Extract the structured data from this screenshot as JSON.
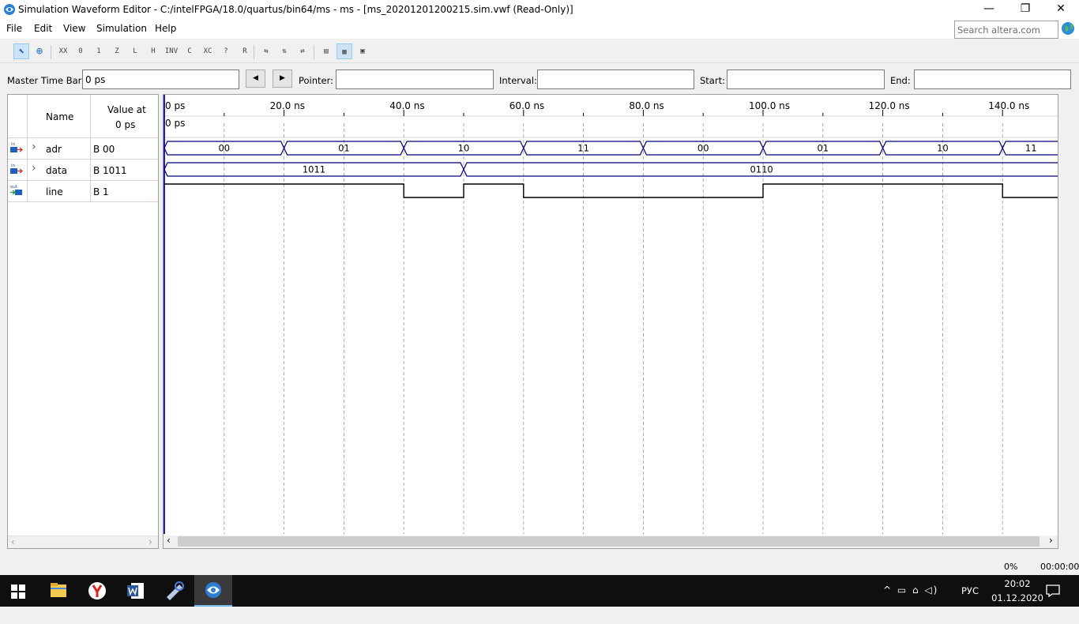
{
  "window": {
    "title": "Simulation Waveform Editor - C:/intelFPGA/18.0/quartus/bin64/ms - ms - [ms_20201201200215.sim.vwf (Read-Only)]",
    "minimize": "—",
    "restore": "❐",
    "close": "✕"
  },
  "menu": [
    "File",
    "Edit",
    "View",
    "Simulation",
    "Help"
  ],
  "search": {
    "placeholder": "Search altera.com"
  },
  "toolbar": {
    "buttons": [
      "select",
      "zoom",
      "uninitialized",
      "forcing-low",
      "forcing-high",
      "high-impedance",
      "weak-low",
      "weak-high",
      "invert",
      "count-value",
      "clock",
      "arbitrary-value",
      "random-value",
      "snap-to-grid",
      "sort",
      "grid-size",
      "overwrite-clock",
      "waveform-view",
      "tabular-view"
    ],
    "labels": [
      "⬉",
      "⊕",
      "XX",
      "0",
      "1",
      "Z",
      "L",
      "H",
      "INV",
      "C",
      "XC",
      "?",
      "R",
      "⇆",
      "⇅",
      "⇄",
      "▤",
      "▦",
      "▣"
    ]
  },
  "timebar": {
    "master_label": "Master Time Bar:",
    "master_value": "0 ps",
    "prev_label": "◀",
    "next_label": "▶",
    "pointer_label": "Pointer:",
    "pointer_value": "",
    "interval_label": "Interval:",
    "interval_value": "",
    "start_label": "Start:",
    "start_value": "",
    "end_label": "End:",
    "end_value": ""
  },
  "signal_table": {
    "col_name": "Name",
    "col_value_line1": "Value at",
    "col_value_line2": "0 ps",
    "signals": [
      {
        "dir": "in",
        "expand": "›",
        "name": "adr",
        "value": "B 00"
      },
      {
        "dir": "in",
        "expand": "›",
        "name": "data",
        "value": "B 1011"
      },
      {
        "dir": "out",
        "expand": "",
        "name": "line",
        "value": "B 1"
      }
    ]
  },
  "waveform": {
    "time_labels": [
      "0 ps",
      "20.0 ns",
      "40.0 ns",
      "60.0 ns",
      "80.0 ns",
      "100.0 ns",
      "120.0 ns",
      "140.0 ns"
    ],
    "cursor_label": "0 ps",
    "adr_segments": [
      {
        "start": 0,
        "end": 20,
        "value": "00"
      },
      {
        "start": 20,
        "end": 40,
        "value": "01"
      },
      {
        "start": 40,
        "end": 60,
        "value": "10"
      },
      {
        "start": 60,
        "end": 80,
        "value": "11"
      },
      {
        "start": 80,
        "end": 100,
        "value": "00"
      },
      {
        "start": 100,
        "end": 120,
        "value": "01"
      },
      {
        "start": 120,
        "end": 140,
        "value": "10"
      },
      {
        "start": 140,
        "end": 149.5,
        "value": "11"
      }
    ],
    "data_segments": [
      {
        "start": 0,
        "end": 50,
        "value": "1011"
      },
      {
        "start": 50,
        "end": 149.5,
        "value": "0110"
      }
    ],
    "line_levels": [
      {
        "start": 0,
        "end": 40,
        "level": 1
      },
      {
        "start": 40,
        "end": 50,
        "level": 0
      },
      {
        "start": 50,
        "end": 60,
        "level": 1
      },
      {
        "start": 60,
        "end": 100,
        "level": 0
      },
      {
        "start": 100,
        "end": 140,
        "level": 1
      },
      {
        "start": 140,
        "end": 149.5,
        "level": 0
      }
    ]
  },
  "scroll": {
    "left": "‹",
    "right": "›"
  },
  "status": {
    "progress": "0%",
    "elapsed": "00:00:00"
  },
  "taskbar": {
    "lang": "РУС",
    "time": "20:02",
    "date": "01.12.2020",
    "tray_icons": "^ ▭ ⌂ ◁)"
  },
  "colors": {
    "wave": "#00007a",
    "accent": "#0078d7",
    "taskbar": "#0f0f10"
  }
}
